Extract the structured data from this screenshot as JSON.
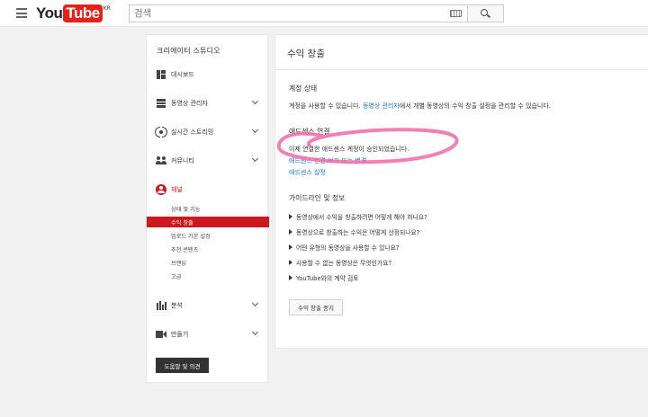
{
  "header": {
    "logo_you": "You",
    "logo_tube": "Tube",
    "logo_region": "KR",
    "search_placeholder": "검색"
  },
  "sidebar": {
    "title": "크리에이터 스튜디오",
    "items": [
      {
        "label": "대시보드",
        "icon": "dashboard-icon"
      },
      {
        "label": "동영상 관리자",
        "icon": "video-manager-icon"
      },
      {
        "label": "실시간 스트리밍",
        "icon": "live-stream-icon"
      },
      {
        "label": "커뮤니티",
        "icon": "community-icon"
      },
      {
        "label": "채널",
        "icon": "channel-icon"
      },
      {
        "label": "분석",
        "icon": "analytics-icon"
      },
      {
        "label": "만들기",
        "icon": "create-icon"
      }
    ],
    "channel_subitems": [
      "상태 및 기능",
      "수익 창출",
      "업로드 기본 설정",
      "추천 콘텐츠",
      "브랜딩",
      "고급"
    ],
    "help_button": "도움말 및 의견"
  },
  "main": {
    "title": "수익 창출",
    "account_status": {
      "heading": "계정 상태",
      "text_before": "계정을 사용할 수 있습니다. ",
      "link": "동영상 관리자",
      "text_after": "에서 개별 동영상의 수익 창출 설정을 관리할 수 있습니다."
    },
    "adsense": {
      "heading": "애드센스 연결",
      "approved_text": "이제 연결한 애드센스 계정이 승인되었습니다.",
      "change_link": "애드센스 연결 보기 또는 변경",
      "settings_link": "애드센스 설정"
    },
    "guidelines": {
      "heading": "가이드라인 및 정보",
      "items": [
        "동영상에서 수익을 창출하려면 어떻게 해야 하나요?",
        "동영상으로 창출하는 수익은 어떻게 산정되나요?",
        "어떤 유형의 동영상을 사용할 수 있나요?",
        "사용할 수 없는 동영상은 무엇인가요?",
        "YouTube와의 계약 검토"
      ]
    },
    "stop_button": "수익 창출 중지"
  },
  "colors": {
    "brand_red": "#e62117",
    "active_red": "#cc181e",
    "link_blue": "#167ac6",
    "annotation_pink": "#f06aa8"
  }
}
